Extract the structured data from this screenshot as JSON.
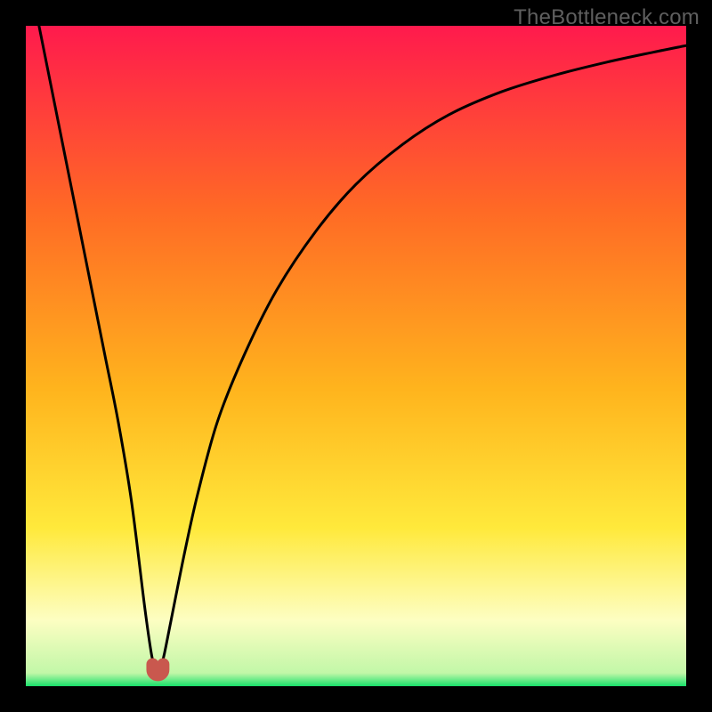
{
  "watermark": "TheBottleneck.com",
  "colors": {
    "frame": "#000000",
    "grad_top": "#ff1a4d",
    "grad_upper_mid": "#ff6a25",
    "grad_mid": "#ffb41d",
    "grad_lower_mid": "#ffe93b",
    "grad_pale": "#fdfec2",
    "grad_green": "#18e06a",
    "curve": "#000000",
    "highlight_fill": "#c9584e",
    "highlight_stroke": "#c9584e"
  },
  "chart_data": {
    "type": "line",
    "title": "",
    "xlabel": "",
    "ylabel": "",
    "xlim": [
      0,
      100
    ],
    "ylim": [
      0,
      100
    ],
    "series": [
      {
        "name": "bottleneck-curve",
        "x": [
          2,
          4,
          6,
          8,
          10,
          12,
          14,
          16,
          18,
          19,
          19.5,
          19.8,
          20,
          20.2,
          20.5,
          21,
          22,
          24,
          26,
          29,
          33,
          38,
          44,
          50,
          57,
          64,
          72,
          80,
          88,
          95,
          100
        ],
        "values": [
          100,
          90,
          80,
          70,
          60,
          50,
          40,
          28,
          12,
          5,
          3,
          2.2,
          2,
          2.2,
          3,
          5,
          10,
          20,
          29,
          40,
          50,
          60,
          69,
          76,
          82,
          86.5,
          90,
          92.5,
          94.5,
          96,
          97
        ]
      }
    ],
    "highlight": {
      "name": "optimum-marker",
      "x_range": [
        19.2,
        20.8
      ],
      "y": 2
    },
    "gradient_stops_percent_from_top": [
      {
        "pct": 0,
        "color": "#ff1a4d"
      },
      {
        "pct": 28,
        "color": "#ff6a25"
      },
      {
        "pct": 55,
        "color": "#ffb41d"
      },
      {
        "pct": 76,
        "color": "#ffe93b"
      },
      {
        "pct": 90,
        "color": "#fdfec2"
      },
      {
        "pct": 98,
        "color": "#c2f7a8"
      },
      {
        "pct": 100,
        "color": "#18e06a"
      }
    ]
  }
}
